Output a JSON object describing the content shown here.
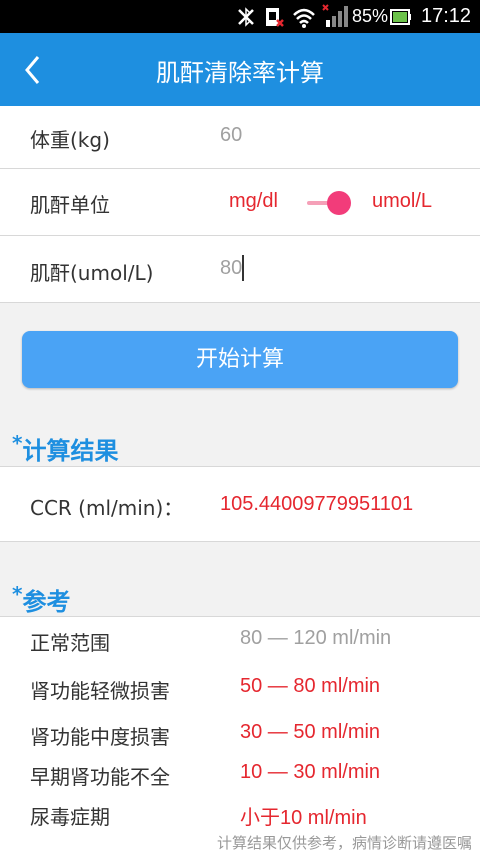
{
  "status_bar": {
    "battery": "85%",
    "time": "17:12",
    "icons": [
      "bluetooth-off-icon",
      "sim-icon",
      "wifi-icon",
      "signal-icon",
      "battery-icon"
    ]
  },
  "app_bar": {
    "title": "肌酐清除率计算",
    "back_icon": "back-chevron-icon"
  },
  "form": {
    "weight": {
      "label": "体重(kg)",
      "value": "60"
    },
    "unit": {
      "label": "肌酐单位",
      "option_left": "mg/dl",
      "option_right": "umol/L",
      "selected": "umol/L"
    },
    "creatinine": {
      "label": "肌酐(umol/L)",
      "value": "80"
    }
  },
  "calc_button": {
    "label": "开始计算"
  },
  "result": {
    "star": "*",
    "title": "计算结果",
    "label": "CCR (ml/min)：",
    "value": "105.44009779951101"
  },
  "reference": {
    "star": "*",
    "title": "参考",
    "items": [
      {
        "label": "正常范围",
        "value": "80 — 120 ml/min"
      },
      {
        "label": "肾功能轻微损害",
        "value": "50 — 80 ml/min"
      },
      {
        "label": "肾功能中度损害",
        "value": "30 — 50 ml/min"
      },
      {
        "label": "早期肾功能不全",
        "value": "10 — 30 ml/min"
      },
      {
        "label": "尿毒症期",
        "value": "小于10 ml/min"
      }
    ]
  },
  "footer": {
    "note": "计算结果仅供参考，病情诊断请遵医嘱"
  },
  "colors": {
    "primary": "#1e8fe0",
    "button": "#4aa3f5",
    "accent_red": "#e5272f",
    "toggle": "#f23c7a"
  }
}
